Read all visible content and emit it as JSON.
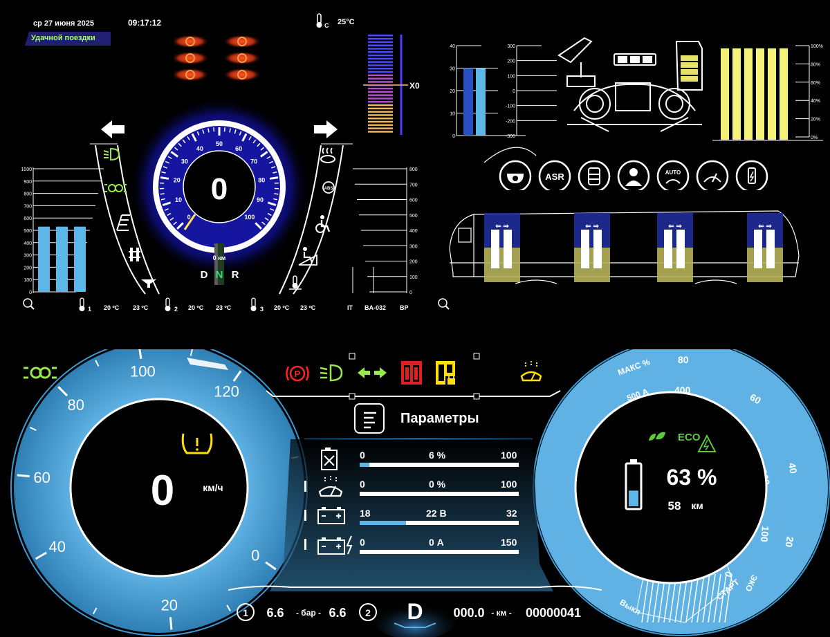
{
  "header": {
    "date": "ср 27 июня 2025",
    "time": "09:17:12",
    "greeting": "Удачной поездки",
    "temp_unit_icon": "°C",
    "temp_outside": "25°C"
  },
  "upper": {
    "xo_label": "X0",
    "speedometer": {
      "speed": "0",
      "ticks": [
        "0",
        "10",
        "20",
        "30",
        "40",
        "50",
        "60",
        "70",
        "80",
        "90",
        "100"
      ],
      "odo_label": "0 км",
      "gears": [
        "D",
        "N",
        "R"
      ]
    },
    "left_bars": {
      "ticks": [
        "1000",
        "900",
        "800",
        "700",
        "600",
        "500",
        "400",
        "300",
        "200",
        "100",
        "0"
      ],
      "values_fraction": [
        0.53,
        0.53,
        0.53
      ]
    },
    "right_scale": {
      "ticks": [
        "800",
        "700",
        "600",
        "500",
        "400",
        "300",
        "200",
        "100",
        "0"
      ],
      "labels": [
        "IT",
        "BA-032",
        "BP"
      ]
    },
    "temps": [
      {
        "index": "1",
        "a": "20 ºC",
        "b": "23 ºC"
      },
      {
        "index": "2",
        "a": "20 ºC",
        "b": "23 ºC"
      },
      {
        "index": "3",
        "a": "20 ºC",
        "b": "23 ºC"
      }
    ],
    "chart40": {
      "ticks": [
        "40",
        "30",
        "20",
        "10",
        "0"
      ],
      "values": [
        30,
        30
      ]
    },
    "chart300": {
      "ticks": [
        "300",
        "200",
        "100",
        "0",
        "-100",
        "-200",
        "-300"
      ]
    },
    "chart_percent": {
      "ticks": [
        "100%",
        "80%",
        "60%",
        "40%",
        "20%",
        "0%"
      ],
      "values": [
        100,
        100,
        100,
        100,
        100,
        100
      ]
    },
    "round_icons": [
      "camera-icon",
      "asr-icon",
      "oil-tank-icon",
      "driver-icon",
      "auto-icon",
      "wiper-icon",
      "usb-charge-icon"
    ],
    "asr_label": "ASR",
    "auto_label": "AUTO"
  },
  "lower": {
    "left_gauge": {
      "ticks": [
        "0",
        "20",
        "40",
        "60",
        "80",
        "100",
        "120"
      ],
      "speed": "0",
      "unit": "км/ч"
    },
    "params_title": "Параметры",
    "params": [
      {
        "min": "0",
        "value": "6 %",
        "max": "100",
        "fraction": 0.06
      },
      {
        "min": "0",
        "value": "0 %",
        "max": "100",
        "fraction": 0.0
      },
      {
        "min": "18",
        "value": "22 В",
        "max": "32",
        "fraction": 0.29
      },
      {
        "min": "0",
        "value": "0 А",
        "max": "150",
        "fraction": 0.0
      }
    ],
    "right_gauge": {
      "labels": [
        "МАКС %",
        "80",
        "500 А",
        "400",
        "60",
        "ФОРСАЖ",
        "200",
        "40",
        "100",
        "20",
        "0",
        "ЭКО",
        "ЗАРЯД",
        "СТАРТ",
        "Выкл"
      ],
      "eco": "ECO",
      "percent": "63 %",
      "range_value": "58",
      "range_unit": "км",
      "battery_fraction": 0.63
    },
    "bottom": {
      "circle1": "1",
      "pressure1": "6.6",
      "pressure_unit": "- бар -",
      "pressure2": "6.6",
      "circle2": "2",
      "gear": "D",
      "trip": "000.0",
      "km_unit": "- км -",
      "odometer": "00000041"
    }
  }
}
